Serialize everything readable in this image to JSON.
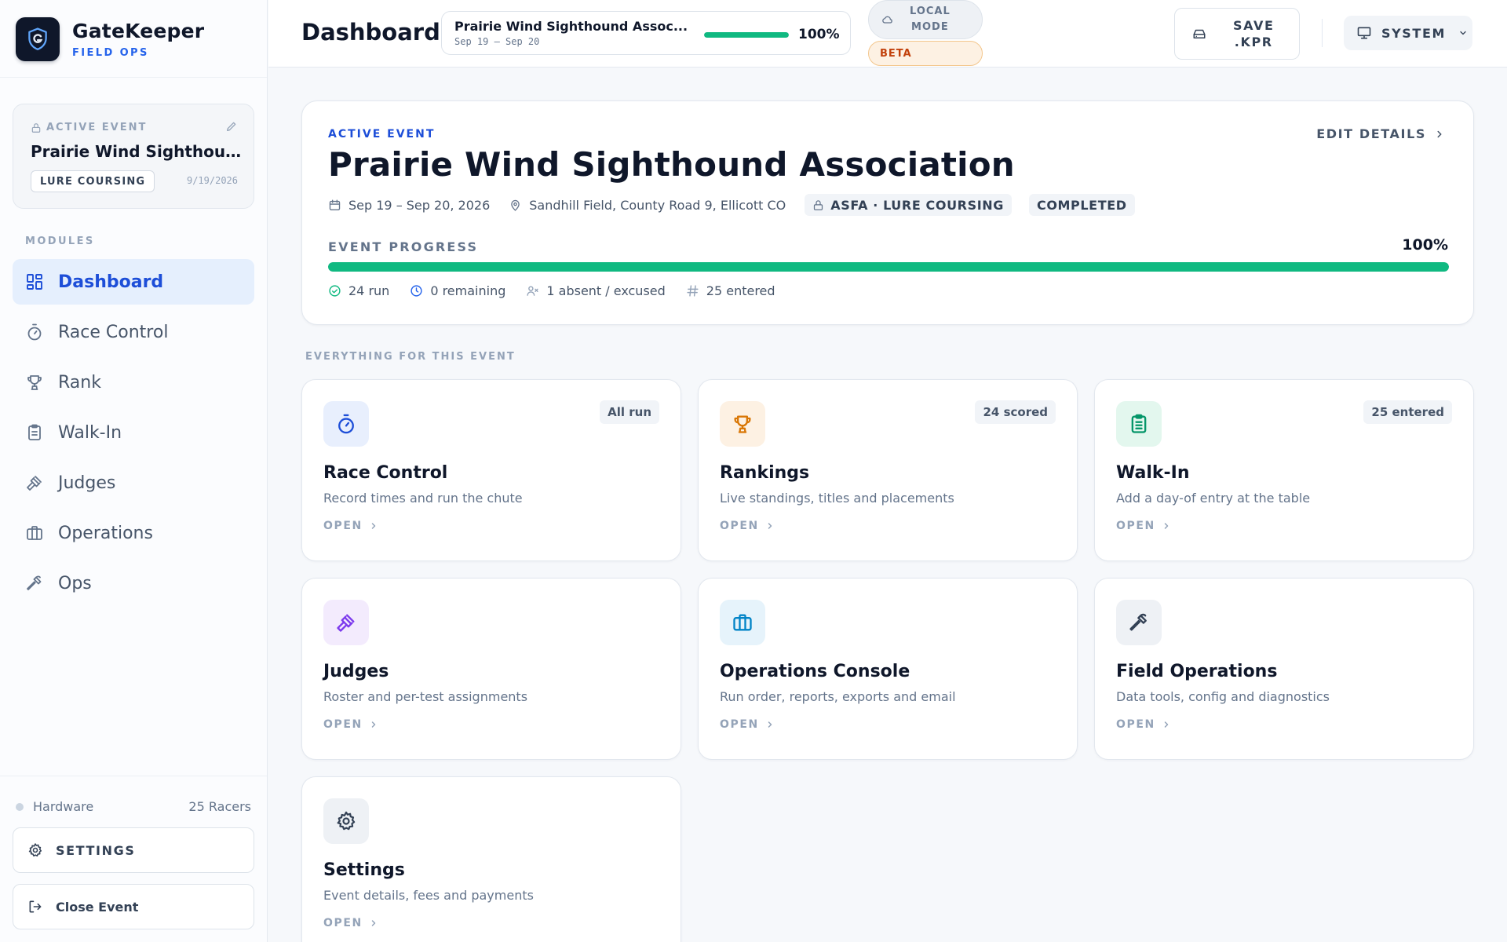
{
  "brand": {
    "name": "GateKeeper",
    "subtitle": "FIELD OPS"
  },
  "sidebar": {
    "active_event": {
      "label": "ACTIVE EVENT",
      "title": "Prairie Wind Sighthou...",
      "badge": "LURE COURSING",
      "date": "9/19/2026"
    },
    "modules_label": "MODULES",
    "items": [
      {
        "label": "Dashboard",
        "icon": "grid-icon",
        "active": true
      },
      {
        "label": "Race Control",
        "icon": "stopwatch-icon",
        "active": false
      },
      {
        "label": "Rank",
        "icon": "trophy-icon",
        "active": false
      },
      {
        "label": "Walk-In",
        "icon": "clipboard-icon",
        "active": false
      },
      {
        "label": "Judges",
        "icon": "gavel-icon",
        "active": false
      },
      {
        "label": "Operations",
        "icon": "briefcase-icon",
        "active": false
      },
      {
        "label": "Ops",
        "icon": "hammer-icon",
        "active": false
      }
    ],
    "footer": {
      "hardware_label": "Hardware",
      "racers_count": "25 Racers",
      "settings_label": "SETTINGS",
      "close_label": "Close Event"
    }
  },
  "header": {
    "title": "Dashboard",
    "event_selector": {
      "name": "Prairie Wind Sighthound Assoc...",
      "dates": "Sep 19 – Sep 20",
      "progress_percent": 100,
      "progress_label": "100%"
    },
    "mode_label_line1": "LOCAL",
    "mode_label_line2": "MODE",
    "beta_label": "BETA",
    "save_label_line1": "SAVE",
    "save_label_line2": ".KPR",
    "system_label": "SYSTEM"
  },
  "summary": {
    "eyebrow": "ACTIVE EVENT",
    "edit_label": "EDIT DETAILS",
    "title": "Prairie Wind Sighthound Association",
    "dates": "Sep 19 – Sep 20, 2026",
    "location": "Sandhill Field, County Road 9, Ellicott CO",
    "category_tag": "ASFA · LURE COURSING",
    "status_tag": "COMPLETED",
    "progress_label": "EVENT PROGRESS",
    "progress_percent": 100,
    "progress_value_label": "100%",
    "stats": {
      "run": "24 run",
      "remaining": "0 remaining",
      "absent": "1 absent / excused",
      "entered": "25 entered"
    }
  },
  "section_label": "EVERYTHING FOR THIS EVENT",
  "cards": [
    {
      "title": "Race Control",
      "description": "Record times and run the chute",
      "badge": "All run",
      "open_label": "OPEN",
      "icon": "stopwatch-icon"
    },
    {
      "title": "Rankings",
      "description": "Live standings, titles and placements",
      "badge": "24 scored",
      "open_label": "OPEN",
      "icon": "trophy-icon"
    },
    {
      "title": "Walk-In",
      "description": "Add a day-of entry at the table",
      "badge": "25 entered",
      "open_label": "OPEN",
      "icon": "clipboard-icon"
    },
    {
      "title": "Judges",
      "description": "Roster and per-test assignments",
      "badge": "",
      "open_label": "OPEN",
      "icon": "gavel-icon"
    },
    {
      "title": "Operations Console",
      "description": "Run order, reports, exports and email",
      "badge": "",
      "open_label": "OPEN",
      "icon": "briefcase-icon"
    },
    {
      "title": "Field Operations",
      "description": "Data tools, config and diagnostics",
      "badge": "",
      "open_label": "OPEN",
      "icon": "hammer-icon"
    },
    {
      "title": "Settings",
      "description": "Event details, fees and payments",
      "badge": "",
      "open_label": "OPEN",
      "icon": "gear-icon"
    }
  ],
  "colors": {
    "accent": "#1d4ed8",
    "progress": "#10b981",
    "beta": "#c2410c"
  }
}
